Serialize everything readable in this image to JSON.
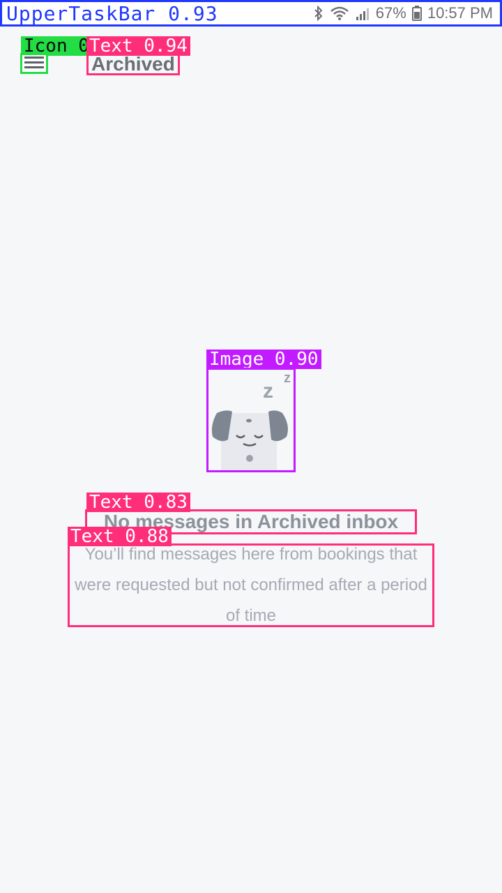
{
  "status_bar": {
    "label": "UpperTaskBar 0.93",
    "battery": "67%",
    "time": "10:57 PM"
  },
  "app_bar": {
    "icon_tag": "Icon 0",
    "title_tag": "Text 0.94",
    "title": "Archived"
  },
  "empty_state": {
    "image_tag": "Image 0.90",
    "title_tag": "Text 0.83",
    "title": "No messages in Archived inbox",
    "desc_tag": "Text 0.88",
    "description": "You’ll find messages here from bookings that were requested but not confirmed after a period of time"
  },
  "colors": {
    "status_border": "#1f37ff",
    "icon_box": "#22dd44",
    "text_box": "#ff2e78",
    "image_box": "#c21bff"
  }
}
